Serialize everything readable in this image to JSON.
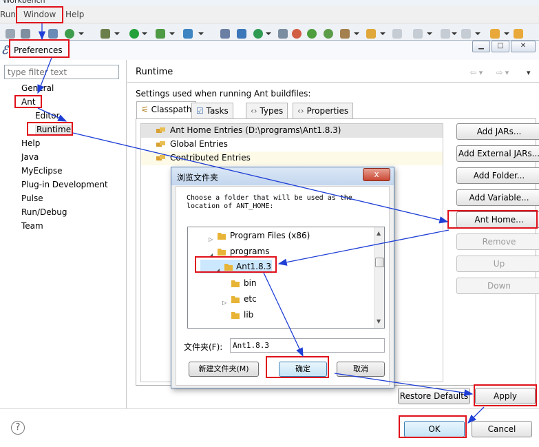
{
  "workbench": {
    "title": "Workbench",
    "menus": [
      "Run",
      "Window",
      "Help"
    ]
  },
  "preferences": {
    "title": "Preferences",
    "filter_placeholder": "type filter text",
    "tree": [
      {
        "label": "General",
        "level": 1
      },
      {
        "label": "Ant",
        "level": 1
      },
      {
        "label": "Editor",
        "level": 2
      },
      {
        "label": "Runtime",
        "level": 2
      },
      {
        "label": "Help",
        "level": 1
      },
      {
        "label": "Java",
        "level": 1
      },
      {
        "label": "MyEclipse",
        "level": 1
      },
      {
        "label": "Plug-in Development",
        "level": 1
      },
      {
        "label": "Pulse",
        "level": 1
      },
      {
        "label": "Run/Debug",
        "level": 1
      },
      {
        "label": "Team",
        "level": 1
      }
    ],
    "page_title": "Runtime",
    "description": "Settings used when running Ant buildfiles:",
    "tabs": [
      "Classpath",
      "Tasks",
      "Types",
      "Properties"
    ],
    "entries": [
      "Ant Home Entries (D:\\programs\\Ant1.8.3)",
      "Global Entries",
      "Contributed Entries"
    ],
    "side_buttons": [
      "Add JARs...",
      "Add External JARs...",
      "Add Folder...",
      "Add Variable...",
      "Ant Home...",
      "Remove",
      "Up",
      "Down"
    ],
    "restore_defaults": "Restore Defaults",
    "apply": "Apply",
    "ok": "OK",
    "cancel": "Cancel",
    "help_glyph": "?"
  },
  "dialog": {
    "title": "浏览文件夹",
    "close_glyph": "x",
    "instruction": "Choose a folder that will be used as the location of ANT_HOME:",
    "folders": [
      "Program Files (x86)",
      "programs",
      "Ant1.8.3",
      "bin",
      "etc",
      "lib"
    ],
    "folder_label": "文件夹(F):",
    "folder_value": "Ant1.8.3",
    "new_folder": "新建文件夹(M)",
    "confirm": "确定",
    "cancel": "取消"
  },
  "colors": {
    "highlight": "#e0101a",
    "arrow": "#1f3fd6",
    "folder": "#e8b437"
  }
}
